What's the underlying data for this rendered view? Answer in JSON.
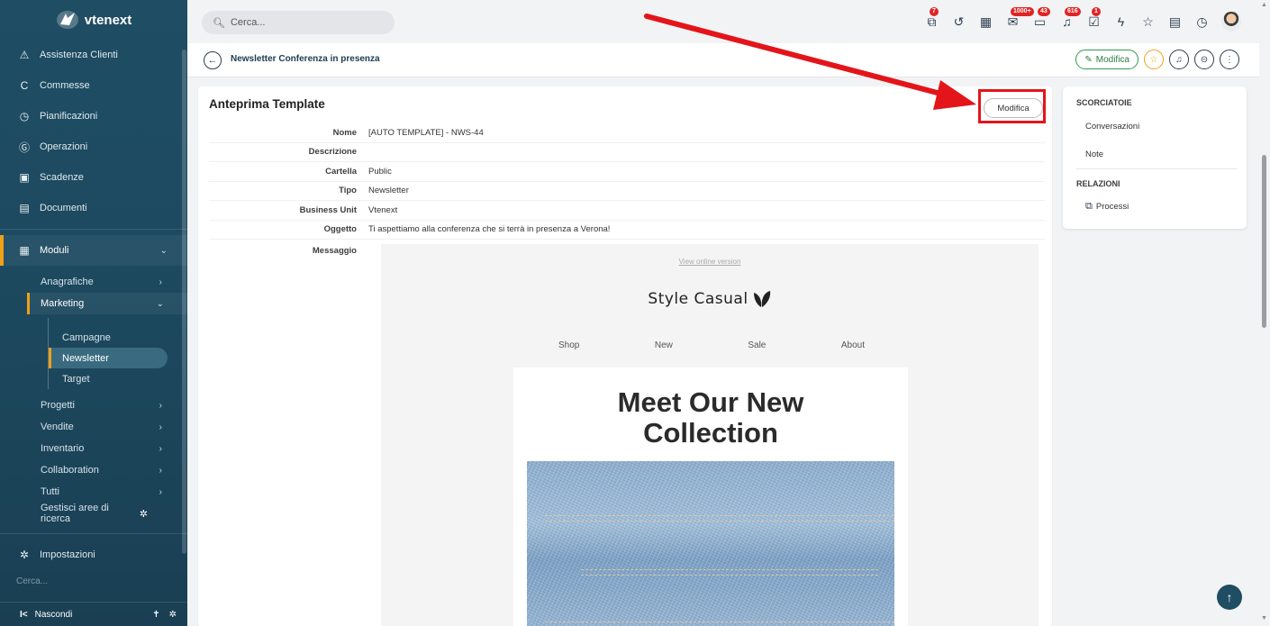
{
  "app": {
    "name": "vtenext"
  },
  "sidebar": {
    "items": [
      {
        "icon": "warning-icon",
        "label": "Assistenza Clienti"
      },
      {
        "icon": "c-icon",
        "label": "Commesse"
      },
      {
        "icon": "clock-icon",
        "label": "Pianificazioni"
      },
      {
        "icon": "gear-g-icon",
        "label": "Operazioni"
      },
      {
        "icon": "calendar-icon",
        "label": "Scadenze"
      },
      {
        "icon": "document-icon",
        "label": "Documenti"
      }
    ],
    "moduli": {
      "label": "Moduli"
    },
    "sub": [
      {
        "label": "Anagrafiche"
      },
      {
        "label": "Marketing"
      }
    ],
    "marketing_children": [
      {
        "label": "Campagne"
      },
      {
        "label": "Newsletter"
      },
      {
        "label": "Target"
      }
    ],
    "more": [
      {
        "label": "Progetti"
      },
      {
        "label": "Vendite"
      },
      {
        "label": "Inventario"
      },
      {
        "label": "Collaboration"
      },
      {
        "label": "Tutti"
      }
    ],
    "manage": "Gestisci aree di ricerca",
    "settings": "Impostazioni",
    "search_placeholder": "Cerca...",
    "hide": "Nascondi"
  },
  "topbar": {
    "search_placeholder": "Cerca...",
    "badges": {
      "processes": "7",
      "calendar_mail": "1000+",
      "messages": "43",
      "notifications": "616",
      "tasks": "1"
    }
  },
  "header": {
    "record_title": "Newsletter Conferenza in presenza",
    "edit_label": "Modifica"
  },
  "card": {
    "title": "Anteprima Template",
    "edit_label": "Modifica",
    "fields": [
      {
        "label": "Nome",
        "value": "[AUTO TEMPLATE] - NWS-44"
      },
      {
        "label": "Descrizione",
        "value": ""
      },
      {
        "label": "Cartella",
        "value": "Public"
      },
      {
        "label": "Tipo",
        "value": "Newsletter"
      },
      {
        "label": "Business Unit",
        "value": "Vtenext"
      },
      {
        "label": "Oggetto",
        "value": "Ti aspettiamo alla conferenza che si terrà in presenza a Verona!"
      }
    ],
    "message_label": "Messaggio"
  },
  "newsletter": {
    "view_online": "View online version",
    "brand": "Style Casual",
    "nav": [
      "Shop",
      "New",
      "Sale",
      "About"
    ],
    "headline_1": "Meet Our New",
    "headline_2": "Collection"
  },
  "shortcuts": {
    "title": "SCORCIATOIE",
    "items": [
      "Conversazioni",
      "Note"
    ],
    "relations_title": "RELAZIONI",
    "relations": [
      "Processi"
    ]
  },
  "colors": {
    "sidebar": "#1f4d63",
    "accent": "#f0a019",
    "annotation": "#e3151a",
    "success": "#2e9b4c"
  }
}
